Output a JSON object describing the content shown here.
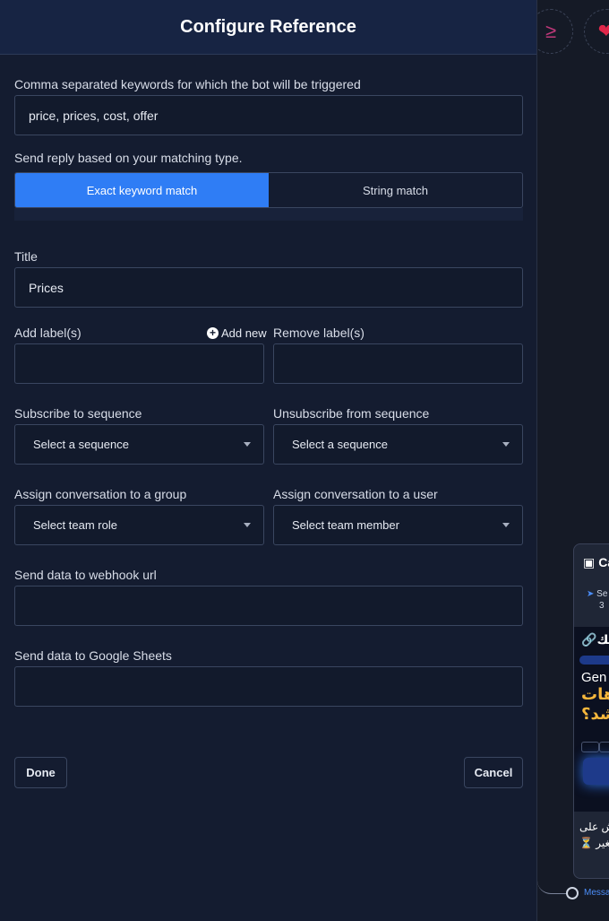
{
  "modal": {
    "title": "Configure Reference",
    "keywords": {
      "label": "Comma separated keywords for which the bot will be triggered",
      "value": "price, prices, cost, offer"
    },
    "matching": {
      "label": "Send reply based on your matching type.",
      "options": [
        "Exact keyword match",
        "String match"
      ],
      "selected": "Exact keyword match"
    },
    "title_field": {
      "label": "Title",
      "value": "Prices"
    },
    "add_labels": {
      "label": "Add label(s)",
      "add_new": "Add new"
    },
    "remove_labels": {
      "label": "Remove label(s)"
    },
    "subscribe": {
      "label": "Subscribe to sequence",
      "value": "Select a sequence"
    },
    "unsubscribe": {
      "label": "Unsubscribe from sequence",
      "value": "Select a sequence"
    },
    "assign_group": {
      "label": "Assign conversation to a group",
      "value": "Select team role"
    },
    "assign_user": {
      "label": "Assign conversation to a user",
      "value": "Select team member"
    },
    "webhook": {
      "label": "Send data to webhook url"
    },
    "sheets": {
      "label": "Send data to Google Sheets"
    },
    "done": "Done",
    "cancel": "Cancel"
  },
  "canvas": {
    "node": {
      "title": "Ca",
      "sent_label": "Se",
      "sent_count": "3",
      "image_text_1": "الك",
      "image_text_2": "Gen",
      "image_text_3": "هات\nشد؟",
      "caption_1": "ش على",
      "caption_2": "⏳ تغير"
    },
    "port_label": "Messag"
  },
  "colors": {
    "accent": "#2f7df5",
    "modal_bg": "#141c30",
    "header_bg": "#172443",
    "input_border": "#3a4660"
  }
}
